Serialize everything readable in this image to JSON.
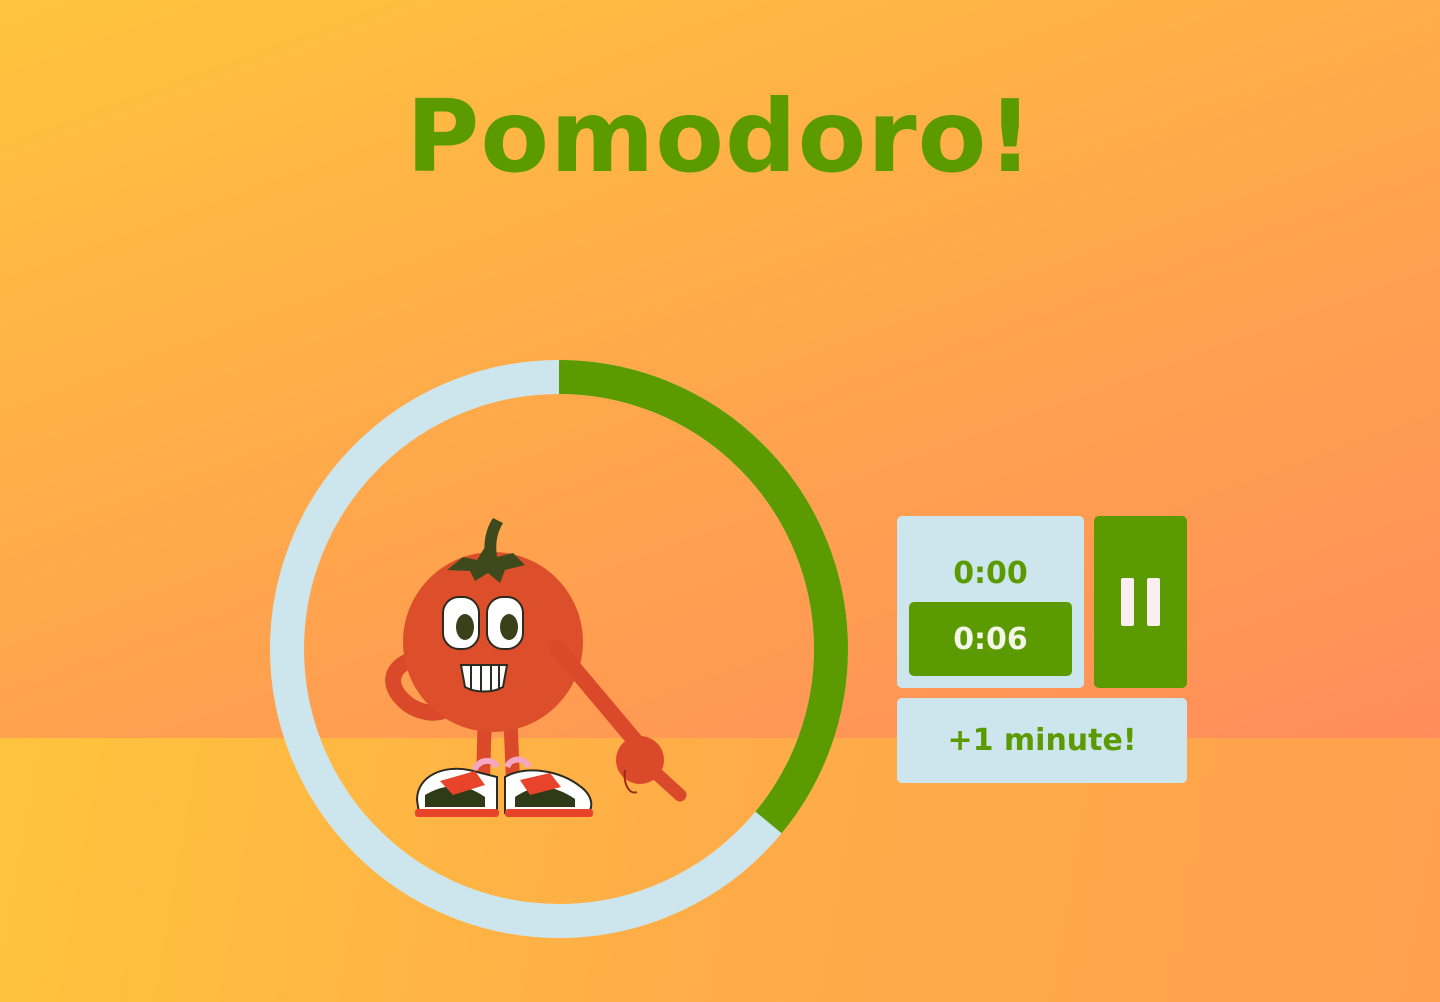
{
  "app": {
    "title": "Pomodoro!"
  },
  "timer": {
    "total": "0:00",
    "elapsed": "0:06",
    "progress_fraction": 0.36,
    "add_minute_label": "+1 minute!",
    "pause_icon": "pause-icon"
  },
  "colors": {
    "accent": "#5b9a00",
    "ring_track": "#cde6ee",
    "panel": "#cde6ee",
    "tomato": "#dd4e2a"
  }
}
